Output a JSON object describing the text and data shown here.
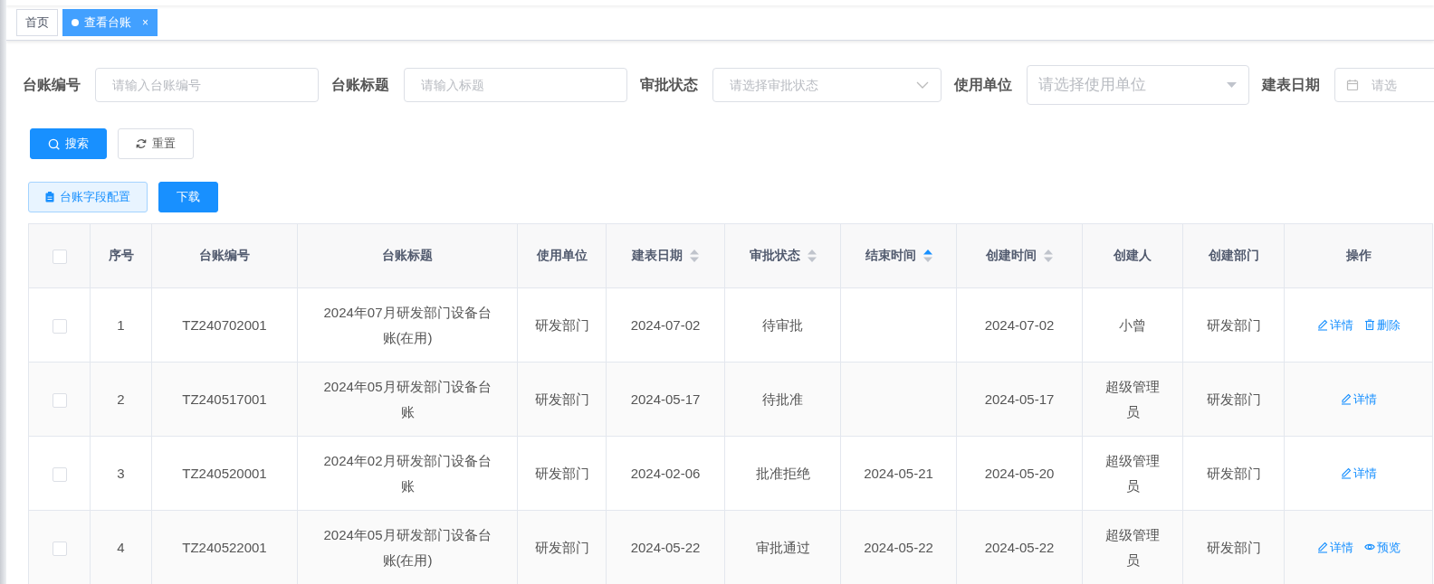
{
  "tabs": [
    {
      "label": "首页",
      "selected": false
    },
    {
      "label": "查看台账",
      "selected": true,
      "close": "×"
    }
  ],
  "filters": [
    {
      "label": "台账编号",
      "kind": "input",
      "placeholder": "请输入台账编号"
    },
    {
      "label": "台账标题",
      "kind": "input",
      "placeholder": "请输入标题"
    },
    {
      "label": "审批状态",
      "kind": "select",
      "placeholder": "请选择审批状态"
    },
    {
      "label": "使用单位",
      "kind": "select-large",
      "placeholder": "请选择使用单位"
    },
    {
      "label": "建表日期",
      "kind": "date",
      "placeholder": "请选"
    }
  ],
  "search_buttons": [
    {
      "label": "搜索",
      "kind": "primary"
    },
    {
      "label": "重置",
      "kind": "reset"
    }
  ],
  "toolbar_buttons": [
    {
      "label": "台账字段配置",
      "kind": "light"
    },
    {
      "label": "下载",
      "kind": "primary"
    }
  ],
  "table": {
    "select_all": {
      "checked": false
    },
    "columns": [
      {
        "label": "序号"
      },
      {
        "label": "台账编号"
      },
      {
        "label": "台账标题"
      },
      {
        "label": "使用单位"
      },
      {
        "label": "建表日期",
        "sortable": true,
        "sorted_ascending": false
      },
      {
        "label": "审批状态",
        "sortable": true,
        "sorted_ascending": false
      },
      {
        "label": "结束时间",
        "sortable": true,
        "sorted_ascending": true
      },
      {
        "label": "创建时间",
        "sortable": true,
        "sorted_ascending": false
      },
      {
        "label": "创建人"
      },
      {
        "label": "创建部门"
      },
      {
        "label": "操作"
      }
    ],
    "rows": [
      {
        "checked": false,
        "cells": [
          "1",
          "TZ240702001",
          "2024年07月研发部门设备台账(在用)",
          "研发部门",
          "2024-07-02",
          "待审批",
          "",
          "2024-07-02",
          "小曾",
          "研发部门"
        ],
        "actions": [
          {
            "kind": "edit",
            "label": "详情"
          },
          {
            "kind": "delete",
            "label": "删除"
          }
        ]
      },
      {
        "checked": false,
        "cells": [
          "2",
          "TZ240517001",
          "2024年05月研发部门设备台账",
          "研发部门",
          "2024-05-17",
          "待批准",
          "",
          "2024-05-17",
          "超级管理员",
          "研发部门"
        ],
        "actions": [
          {
            "kind": "edit",
            "label": "详情"
          }
        ]
      },
      {
        "checked": false,
        "cells": [
          "3",
          "TZ240520001",
          "2024年02月研发部门设备台账",
          "研发部门",
          "2024-02-06",
          "批准拒绝",
          "2024-05-21",
          "2024-05-20",
          "超级管理员",
          "研发部门"
        ],
        "actions": [
          {
            "kind": "edit",
            "label": "详情"
          }
        ]
      },
      {
        "checked": false,
        "cells": [
          "4",
          "TZ240522001",
          "2024年05月研发部门设备台账(在用)",
          "研发部门",
          "2024-05-22",
          "审批通过",
          "2024-05-22",
          "2024-05-22",
          "超级管理员",
          "研发部门"
        ],
        "actions": [
          {
            "kind": "edit",
            "label": "详情"
          },
          {
            "kind": "preview",
            "label": "预览"
          }
        ]
      }
    ]
  }
}
